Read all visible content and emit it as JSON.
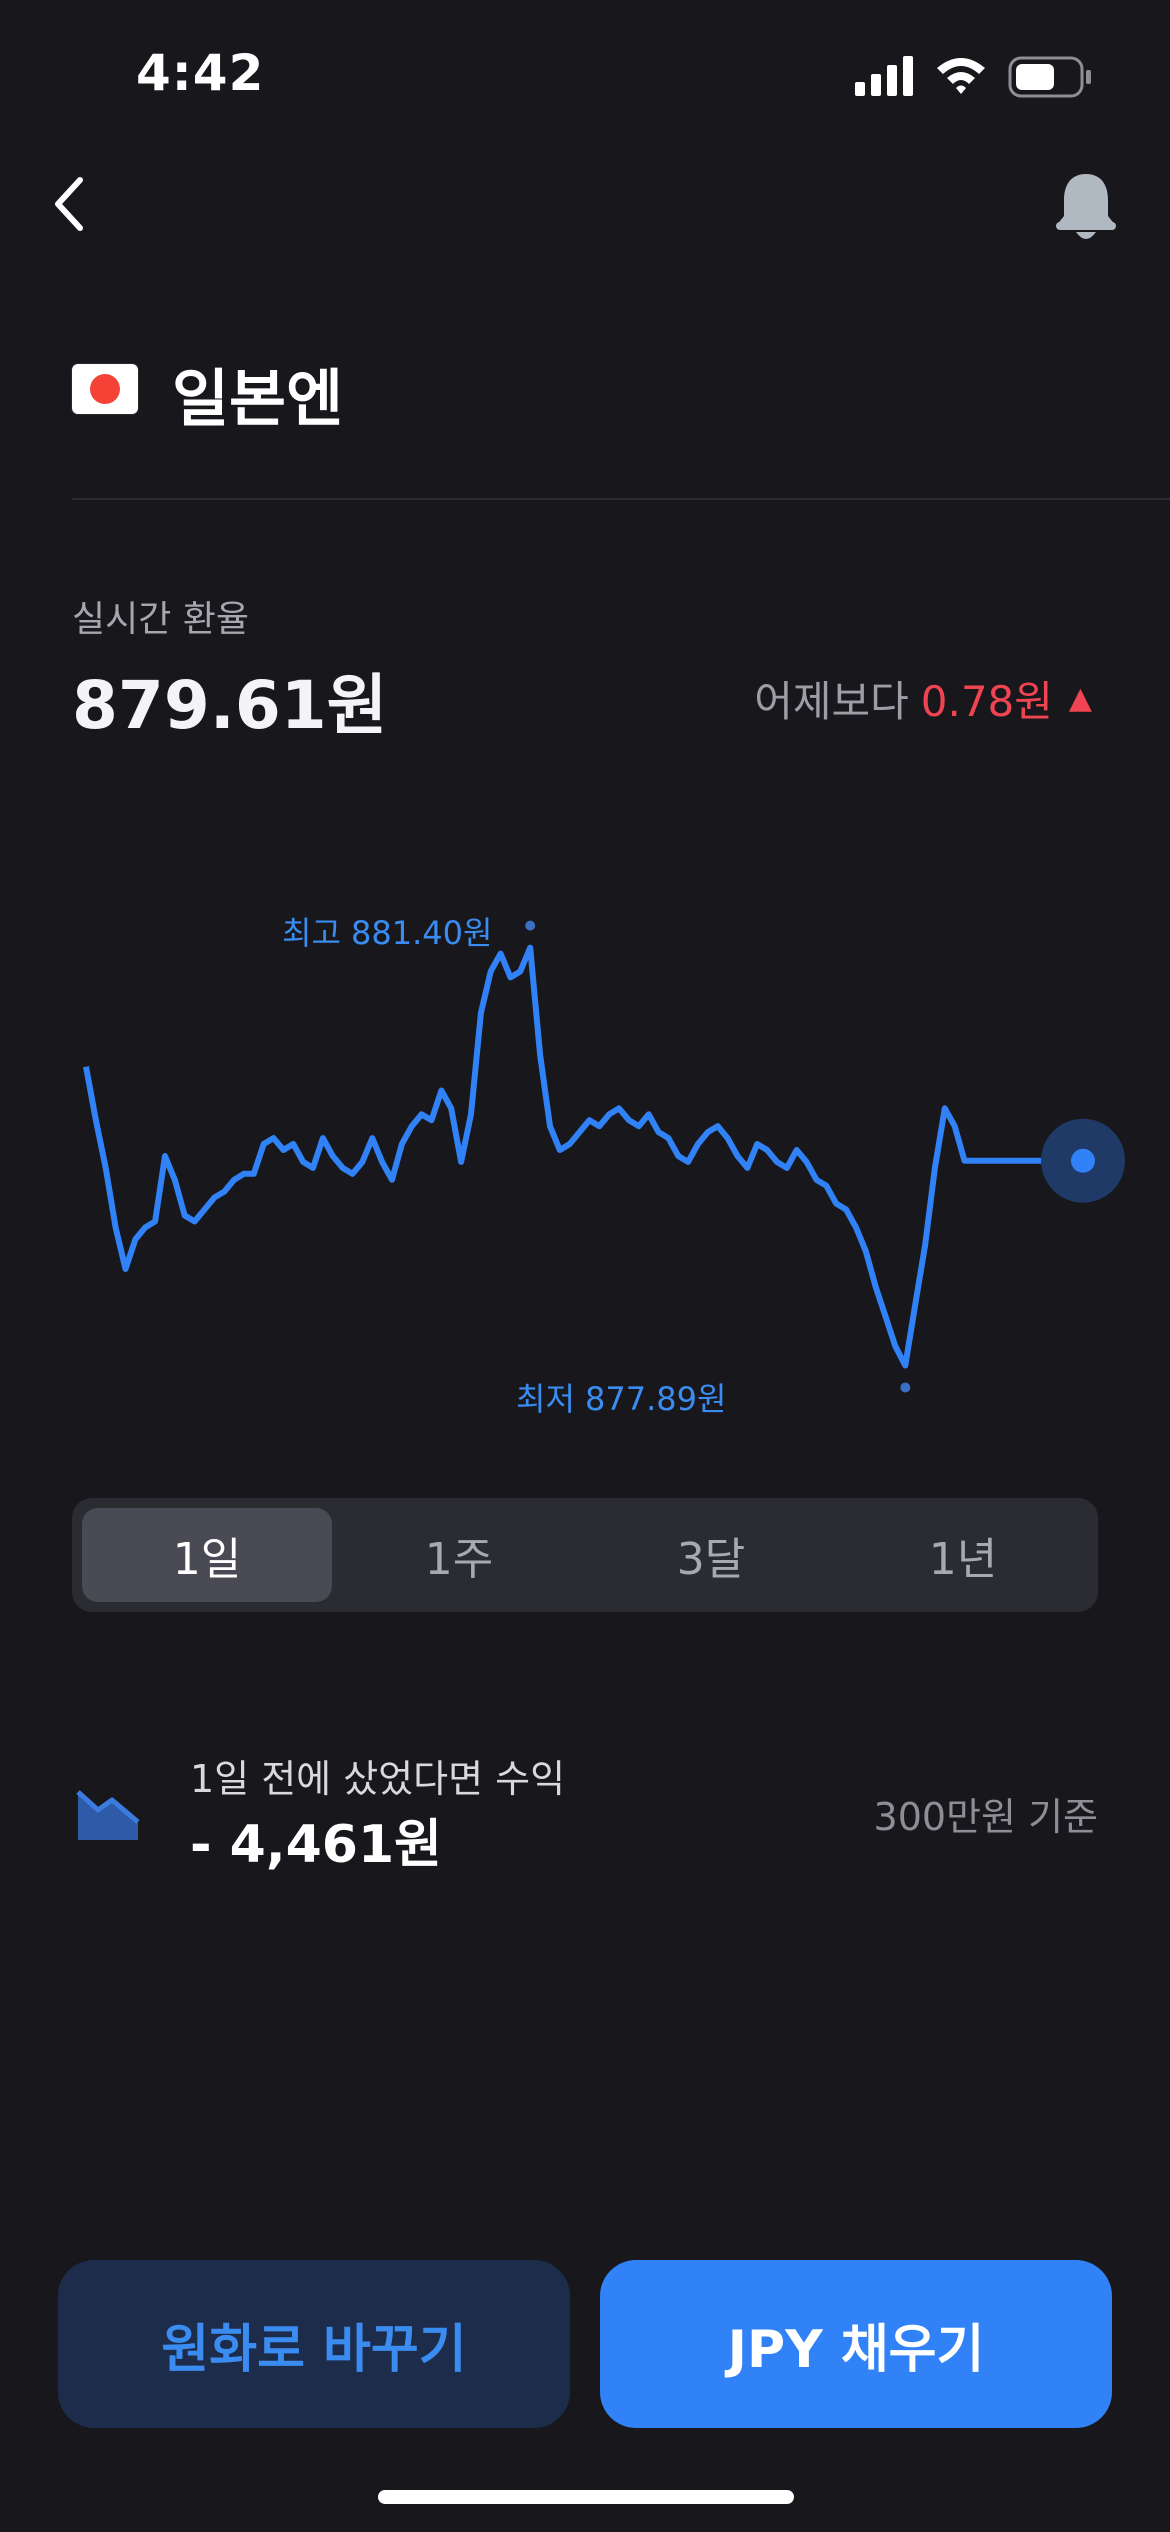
{
  "status_bar": {
    "time": "4:42"
  },
  "header": {
    "title": "일본엔"
  },
  "rate": {
    "label": "실시간 환율",
    "value": "879.61원",
    "change_prefix": "어제보다",
    "change_value": "0.78원",
    "change_arrow": "▲"
  },
  "chart_data": {
    "type": "line",
    "high_label": "최고 881.40원",
    "low_label": "최저 877.89원",
    "ylim": [
      877.6,
      881.8
    ],
    "series": [
      {
        "values": [
          880.4,
          879.95,
          879.55,
          879.05,
          878.7,
          878.95,
          879.05,
          879.1,
          879.65,
          879.45,
          879.15,
          879.1,
          879.2,
          879.3,
          879.35,
          879.45,
          879.5,
          879.5,
          879.75,
          879.8,
          879.7,
          879.75,
          879.6,
          879.55,
          879.8,
          879.65,
          879.55,
          879.5,
          879.6,
          879.8,
          879.6,
          879.45,
          879.75,
          879.9,
          880.0,
          879.95,
          880.2,
          880.05,
          879.6,
          880.0,
          880.85,
          881.2,
          881.35,
          881.15,
          881.2,
          881.4,
          880.5,
          879.9,
          879.7,
          879.75,
          879.85,
          879.95,
          879.9,
          880.0,
          880.05,
          879.95,
          879.9,
          880.0,
          879.85,
          879.8,
          879.65,
          879.6,
          879.75,
          879.85,
          879.9,
          879.8,
          879.65,
          879.55,
          879.75,
          879.7,
          879.6,
          879.55,
          879.7,
          879.6,
          879.45,
          879.4,
          879.25,
          879.2,
          879.05,
          878.85,
          878.55,
          878.3,
          878.05,
          877.89,
          878.4,
          878.9,
          879.55,
          880.05,
          879.9,
          879.61,
          879.61,
          879.61,
          879.61,
          879.61,
          879.61,
          879.61,
          879.61,
          879.61,
          879.61,
          879.61,
          879.61,
          879.61
        ]
      }
    ]
  },
  "periods": {
    "tabs": [
      {
        "label": "1일",
        "active": true
      },
      {
        "label": "1주",
        "active": false
      },
      {
        "label": "3달",
        "active": false
      },
      {
        "label": "1년",
        "active": false
      }
    ]
  },
  "profit": {
    "label": "1일 전에 샀었다면 수익",
    "value": "- 4,461원",
    "basis": "300만원 기준"
  },
  "actions": {
    "exchange_label": "원화로 바꾸기",
    "fill_label": "JPY 채우기"
  },
  "colors": {
    "accent": "#3182f6",
    "up": "#f04452",
    "background": "#17171c"
  },
  "icons": {
    "back": "chevron-left-icon",
    "bell": "bell-icon",
    "flag": "japan-flag-icon",
    "profit": "chart-down-icon"
  }
}
